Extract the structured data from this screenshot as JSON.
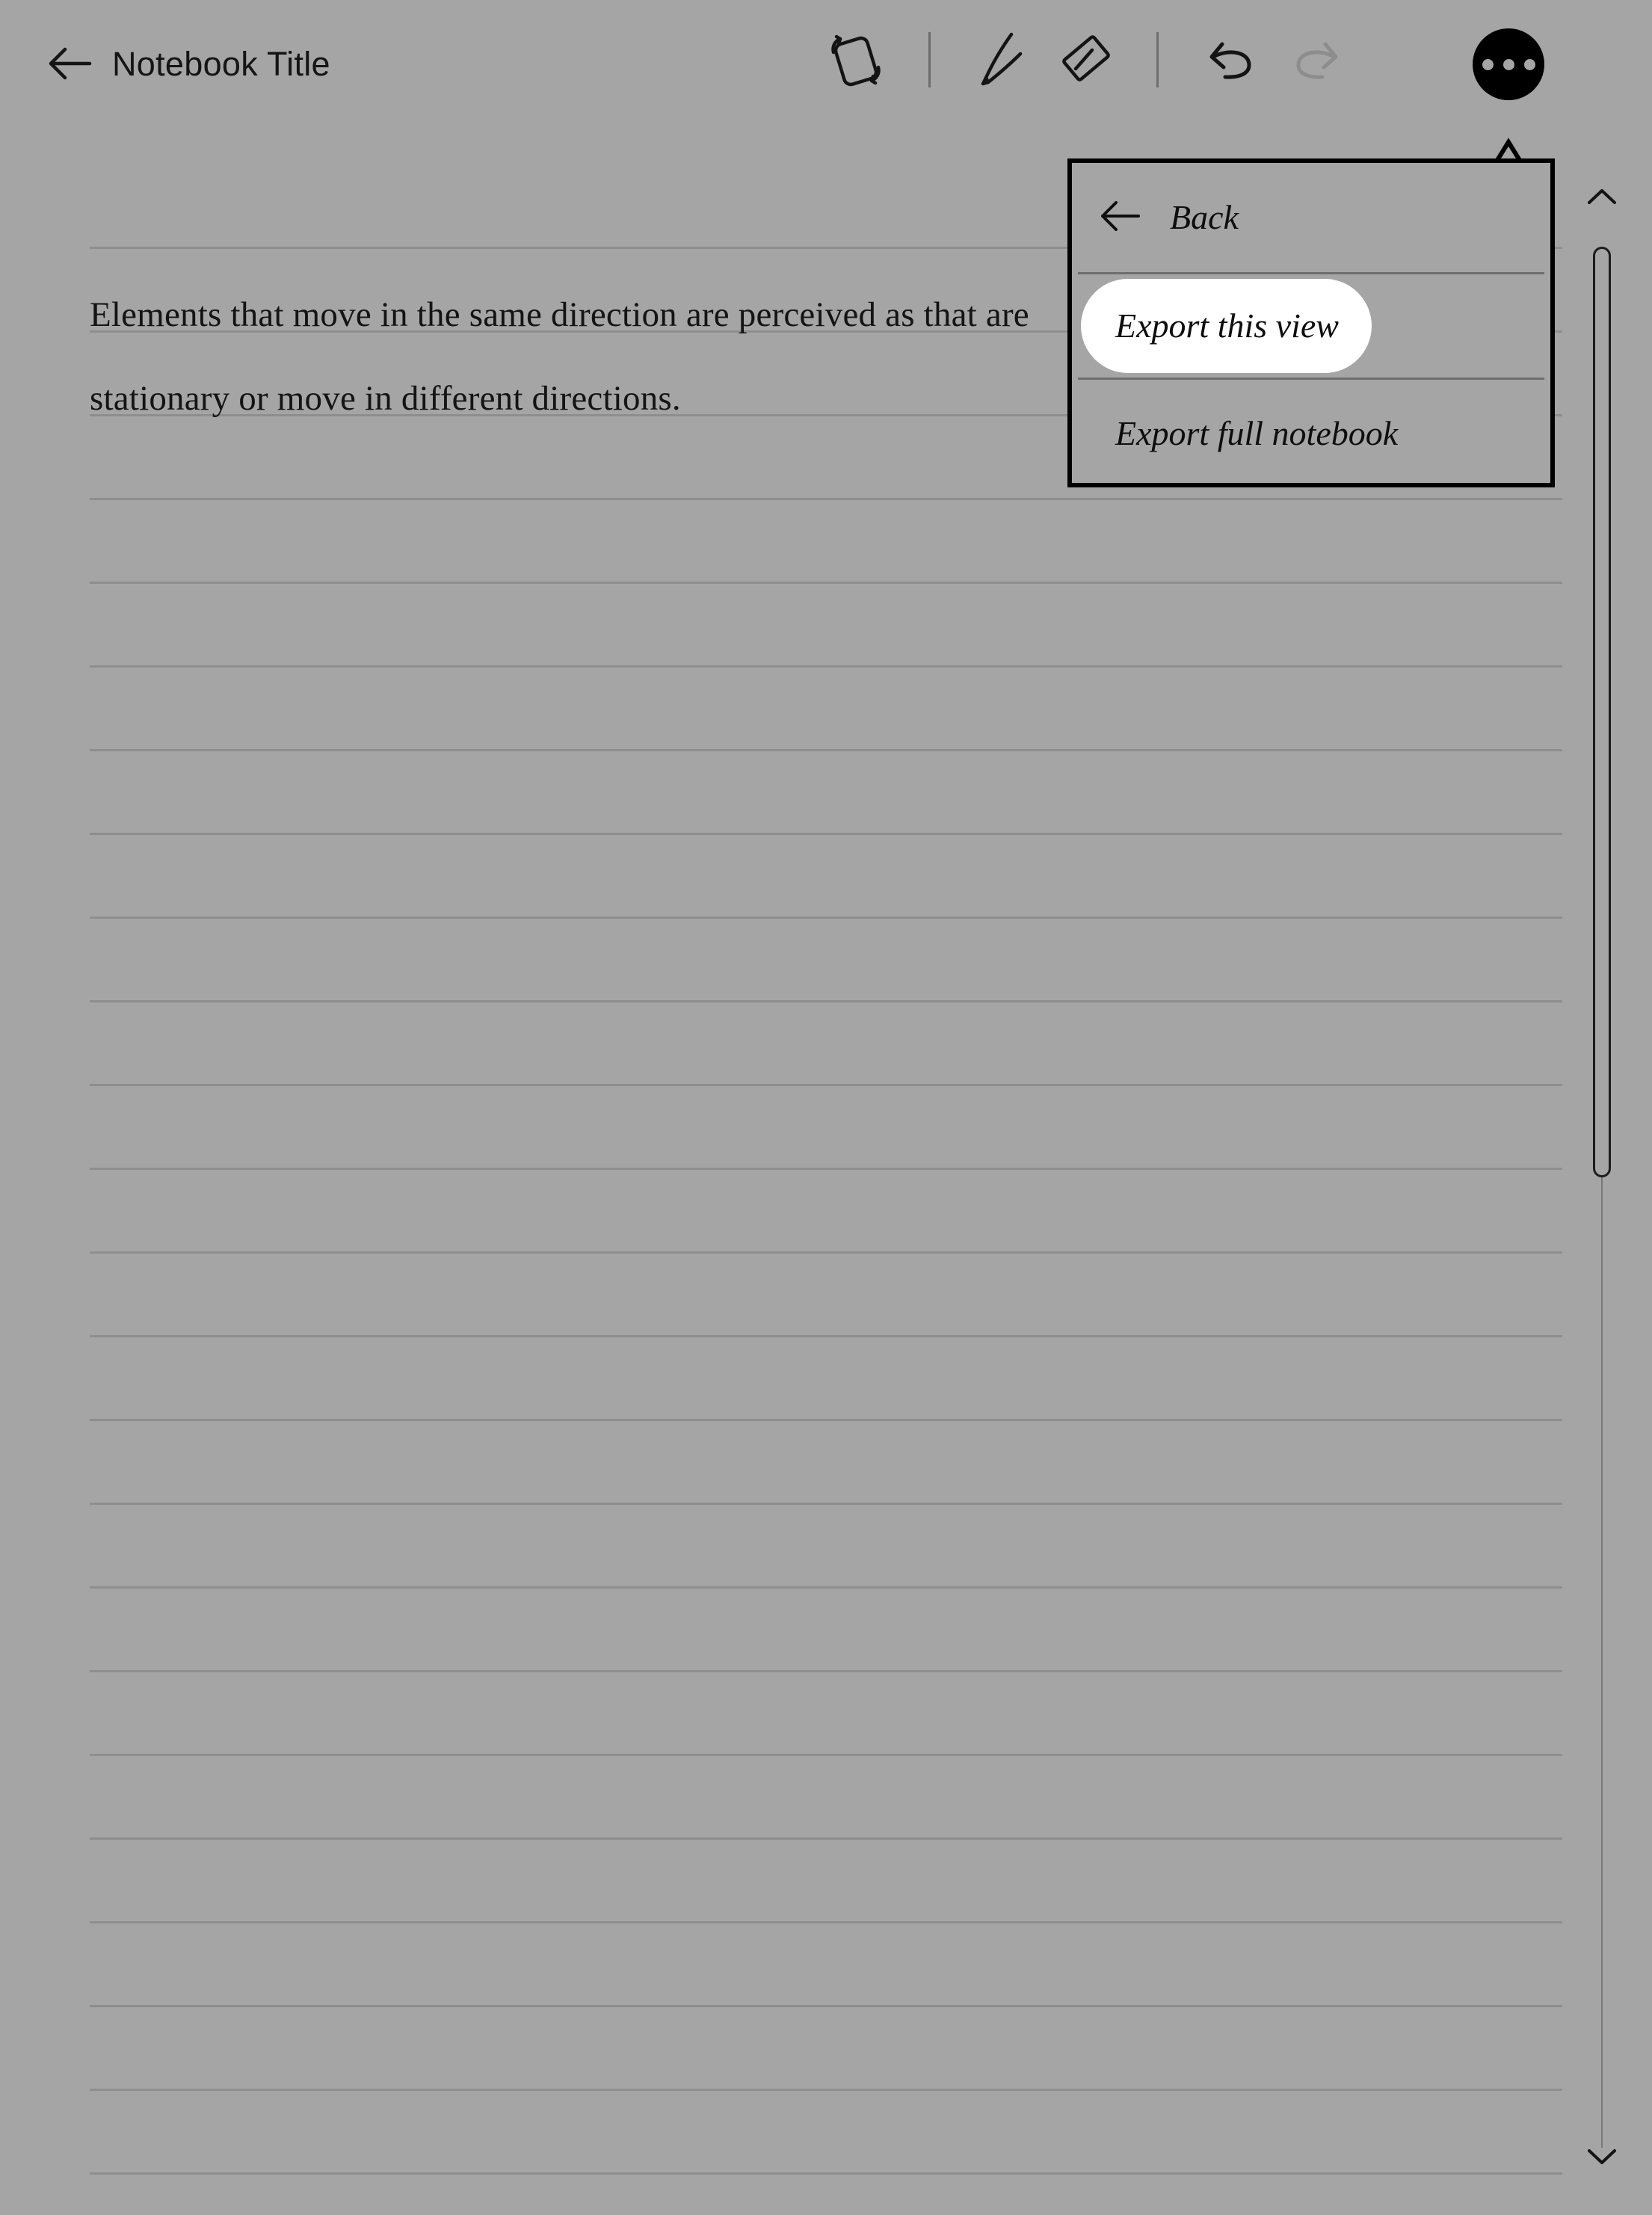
{
  "header": {
    "back_icon": "arrow-left-icon",
    "title": "Notebook Title",
    "tools": [
      {
        "name": "rotate-orientation-icon",
        "label": "Rotate page orientation",
        "state": "enabled"
      },
      {
        "name": "pen-icon",
        "label": "Pen",
        "state": "enabled"
      },
      {
        "name": "eraser-icon",
        "label": "Eraser",
        "state": "enabled"
      },
      {
        "name": "undo-icon",
        "label": "Undo",
        "state": "enabled"
      },
      {
        "name": "redo-icon",
        "label": "Redo",
        "state": "disabled"
      }
    ],
    "more_button": {
      "name": "more-options-icon",
      "label": "More options",
      "state": "active"
    }
  },
  "note": {
    "body": "Elements that move in the same direction are perceived as that are stationary or move in different directions.",
    "line1": "Elements that move in the same direction are perceived as",
    "line2": "that are stationary or move in different directions."
  },
  "menu": {
    "back": {
      "icon": "arrow-left-icon",
      "label": "Back"
    },
    "items": [
      {
        "label": "Export this view",
        "highlighted": true
      },
      {
        "label": "Export full notebook",
        "highlighted": false
      }
    ]
  },
  "scrollbar": {
    "up_icon": "chevron-up-icon",
    "down_icon": "chevron-down-icon"
  },
  "colors": {
    "background": "#a5a5a5",
    "ink": "#111111",
    "rule_line": "#8e8e8e",
    "highlight": "#ffffff",
    "disabled": "#8d8d8d"
  }
}
